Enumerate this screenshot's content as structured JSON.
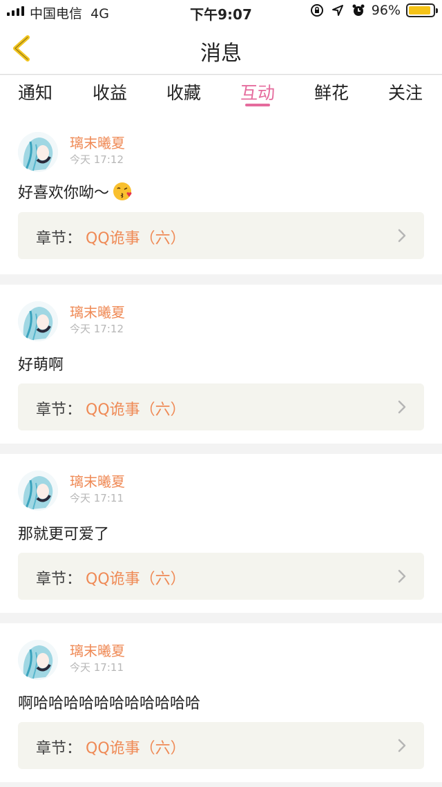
{
  "status_bar": {
    "carrier": "中国电信",
    "network": "4G",
    "time": "下午9:07",
    "battery": "96%"
  },
  "nav": {
    "title": "消息"
  },
  "tabs": [
    {
      "label": "通知",
      "active": false
    },
    {
      "label": "收益",
      "active": false
    },
    {
      "label": "收藏",
      "active": false
    },
    {
      "label": "互动",
      "active": true
    },
    {
      "label": "鲜花",
      "active": false
    },
    {
      "label": "关注",
      "active": false
    }
  ],
  "accent_color": "#e56b9d",
  "name_color": "#ef8a56",
  "messages": [
    {
      "user": "璃末曦夏",
      "time": "今天 17:12",
      "text": "好喜欢你呦～",
      "emoji": "kiss-emoji",
      "chapter_label": "章节：",
      "chapter_name": "QQ诡事（六）"
    },
    {
      "user": "璃末曦夏",
      "time": "今天 17:12",
      "text": "好萌啊",
      "chapter_label": "章节：",
      "chapter_name": "QQ诡事（六）"
    },
    {
      "user": "璃末曦夏",
      "time": "今天 17:11",
      "text": "那就更可爱了",
      "chapter_label": "章节：",
      "chapter_name": "QQ诡事（六）"
    },
    {
      "user": "璃末曦夏",
      "time": "今天 17:11",
      "text": "啊哈哈哈哈哈哈哈哈哈哈哈",
      "chapter_label": "章节：",
      "chapter_name": "QQ诡事（六）"
    }
  ]
}
